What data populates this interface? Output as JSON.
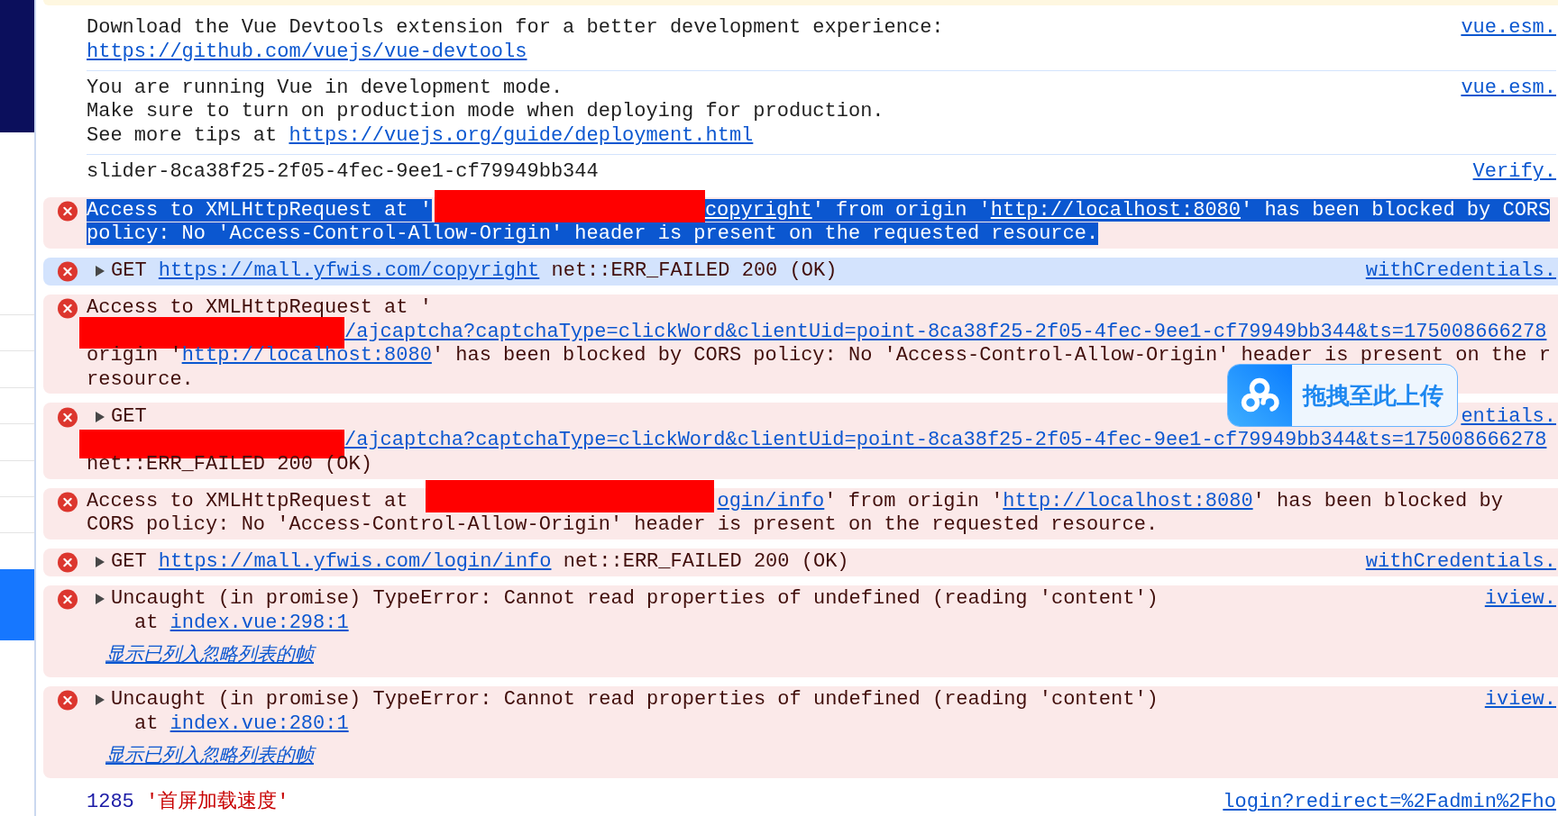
{
  "page_sidebar": {
    "items": [
      {
        "selected": false
      },
      {
        "selected": false
      },
      {
        "selected": false
      },
      {
        "selected": false
      },
      {
        "selected": false
      },
      {
        "selected": false
      },
      {
        "selected": false
      },
      {
        "selected": true
      }
    ]
  },
  "console": {
    "clipped_warning_above": true,
    "messages": [
      {
        "kind": "log",
        "selected": false,
        "text_selected": false,
        "lines": [
          [
            {
              "kind": "text",
              "text": "Download the Vue Devtools extension for a better development experience:"
            }
          ],
          [
            {
              "kind": "link",
              "text": "https://github.com/vuejs/vue-devtools"
            }
          ]
        ],
        "source": "vue.esm."
      },
      {
        "kind": "log",
        "selected": false,
        "text_selected": false,
        "lines": [
          [
            {
              "kind": "text",
              "text": "You are running Vue in development mode."
            }
          ],
          [
            {
              "kind": "text",
              "text": "Make sure to turn on production mode when deploying for production."
            }
          ],
          [
            {
              "kind": "text",
              "text": "See more tips at "
            },
            {
              "kind": "link",
              "text": "https://vuejs.org/guide/deployment.html"
            }
          ]
        ],
        "source": "vue.esm."
      },
      {
        "kind": "log",
        "selected": false,
        "text_selected": false,
        "lines": [
          [
            {
              "kind": "text",
              "text": "slider-8ca38f25-2f05-4fec-9ee1-cf79949bb344"
            }
          ]
        ],
        "source": "Verify."
      },
      {
        "kind": "error",
        "selected": false,
        "text_selected": true,
        "lines": [
          [
            {
              "kind": "text",
              "text": "Access to XMLHttpRequest at '"
            },
            {
              "kind": "redacted"
            },
            {
              "kind": "link",
              "text": "copyright"
            },
            {
              "kind": "text",
              "text": "' from origin '"
            },
            {
              "kind": "link",
              "text": "http://localhost:8080"
            },
            {
              "kind": "text",
              "text": "' has been blocked by CORS"
            }
          ],
          [
            {
              "kind": "text",
              "text": "policy: No 'Access-Control-Allow-Origin' header is present on the requested resource."
            }
          ]
        ]
      },
      {
        "kind": "network",
        "selected": true,
        "text_selected": false,
        "expanded": false,
        "lines": [
          [
            {
              "kind": "text",
              "text": "GET "
            },
            {
              "kind": "link",
              "text": "https://mall.yfwis.com/copyright"
            },
            {
              "kind": "text",
              "text": " net::ERR_FAILED 200 (OK)"
            }
          ]
        ],
        "source": "withCredentials."
      },
      {
        "kind": "error",
        "selected": false,
        "text_selected": false,
        "lines": [
          [
            {
              "kind": "text",
              "text": "Access to XMLHttpRequest at '"
            }
          ],
          [
            {
              "kind": "redacted"
            },
            {
              "kind": "link",
              "text": "/ajcaptcha?captchaType=clickWord&clientUid=point-8ca38f25-2f05-4fec-9ee1-cf79949bb344&ts=175008666278"
            }
          ],
          [
            {
              "kind": "text",
              "text": "origin '"
            },
            {
              "kind": "link",
              "text": "http://localhost:8080"
            },
            {
              "kind": "text",
              "text": "' has been blocked by CORS policy: No 'Access-Control-Allow-Origin' header is present on the r"
            }
          ],
          [
            {
              "kind": "text",
              "text": "resource."
            }
          ]
        ]
      },
      {
        "kind": "network",
        "selected": false,
        "text_selected": false,
        "expanded": false,
        "lines": [
          [
            {
              "kind": "text",
              "text": "GET"
            }
          ],
          [
            {
              "kind": "redacted"
            },
            {
              "kind": "link",
              "text": "/ajcaptcha?captchaType=clickWord&clientUid=point-8ca38f25-2f05-4fec-9ee1-cf79949bb344&ts=175008666278"
            }
          ],
          [
            {
              "kind": "text",
              "text": "net::ERR_FAILED 200 (OK)"
            }
          ]
        ],
        "source": "entials."
      },
      {
        "kind": "error",
        "selected": false,
        "text_selected": false,
        "lines": [
          [
            {
              "kind": "text",
              "text": "Access to XMLHttpRequest at"
            },
            {
              "kind": "redacted"
            },
            {
              "kind": "link",
              "text": "ogin/info"
            },
            {
              "kind": "text",
              "text": "' from origin '"
            },
            {
              "kind": "link",
              "text": "http://localhost:8080"
            },
            {
              "kind": "text",
              "text": "' has been blocked by"
            }
          ],
          [
            {
              "kind": "text",
              "text": "CORS policy: No 'Access-Control-Allow-Origin' header is present on the requested resource."
            }
          ]
        ]
      },
      {
        "kind": "network",
        "selected": false,
        "text_selected": false,
        "expanded": false,
        "lines": [
          [
            {
              "kind": "text",
              "text": "GET "
            },
            {
              "kind": "link",
              "text": "https://mall.yfwis.com/login/info"
            },
            {
              "kind": "text",
              "text": " net::ERR_FAILED 200 (OK)"
            }
          ]
        ],
        "source": "withCredentials."
      },
      {
        "kind": "exception",
        "selected": false,
        "text_selected": false,
        "expanded": false,
        "lines": [
          [
            {
              "kind": "text",
              "text": "Uncaught (in promise) TypeError: Cannot read properties of undefined (reading 'content')"
            }
          ]
        ],
        "stack": [
          {
            "text": "at",
            "link": "index.vue:298:1"
          }
        ],
        "ignore_list_link": "显示已列入忽略列表的帧",
        "source": "iview."
      },
      {
        "kind": "exception",
        "selected": false,
        "text_selected": false,
        "expanded": false,
        "lines": [
          [
            {
              "kind": "text",
              "text": "Uncaught (in promise) TypeError: Cannot read properties of undefined (reading 'content')"
            }
          ]
        ],
        "stack": [
          {
            "text": "at",
            "link": "index.vue:280:1"
          }
        ],
        "ignore_list_link": "显示已列入忽略列表的帧",
        "source": "iview."
      },
      {
        "kind": "log",
        "selected": false,
        "text_selected": false,
        "lines": [
          [
            {
              "kind": "number",
              "text": "1285"
            },
            {
              "kind": "string",
              "text": "'首屏加载速度'"
            }
          ]
        ],
        "source": "login?redirect=%2Fadmin%2Fho"
      }
    ]
  },
  "upload_widget": {
    "label": "拖拽至此上传"
  }
}
